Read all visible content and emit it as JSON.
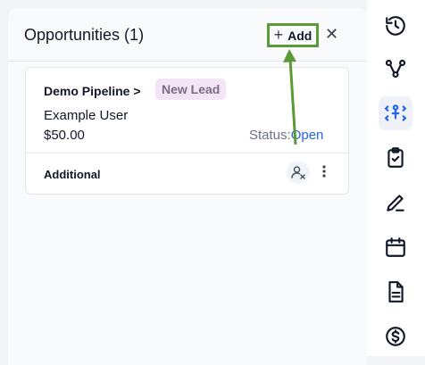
{
  "panel": {
    "title": "Opportunities (1)",
    "add_label": "Add",
    "icons": {
      "add": "plus-icon",
      "close": "close-icon"
    }
  },
  "card": {
    "pipeline": "Demo Pipeline >",
    "stage": "New Lead",
    "contact": "Example User",
    "amount": "$50.00",
    "status_label": "Status:",
    "status_value": "Open",
    "additional_label": "Additional",
    "icons": {
      "assign": "user-unassigned-icon",
      "more": "more-vertical-icon"
    }
  },
  "rail": {
    "items": [
      {
        "icon": "history-icon",
        "active": false
      },
      {
        "icon": "workflow-icon",
        "active": false
      },
      {
        "icon": "opportunities-icon",
        "active": true
      },
      {
        "icon": "tasks-icon",
        "active": false
      },
      {
        "icon": "notes-icon",
        "active": false
      },
      {
        "icon": "calendar-icon",
        "active": false
      },
      {
        "icon": "document-icon",
        "active": false
      },
      {
        "icon": "payments-icon",
        "active": false
      }
    ]
  },
  "colors": {
    "highlight": "#5c9a35",
    "stage_bg": "#f3e5f6",
    "link": "#2563eb",
    "icon": "#111827",
    "active_icon": "#2563eb"
  }
}
